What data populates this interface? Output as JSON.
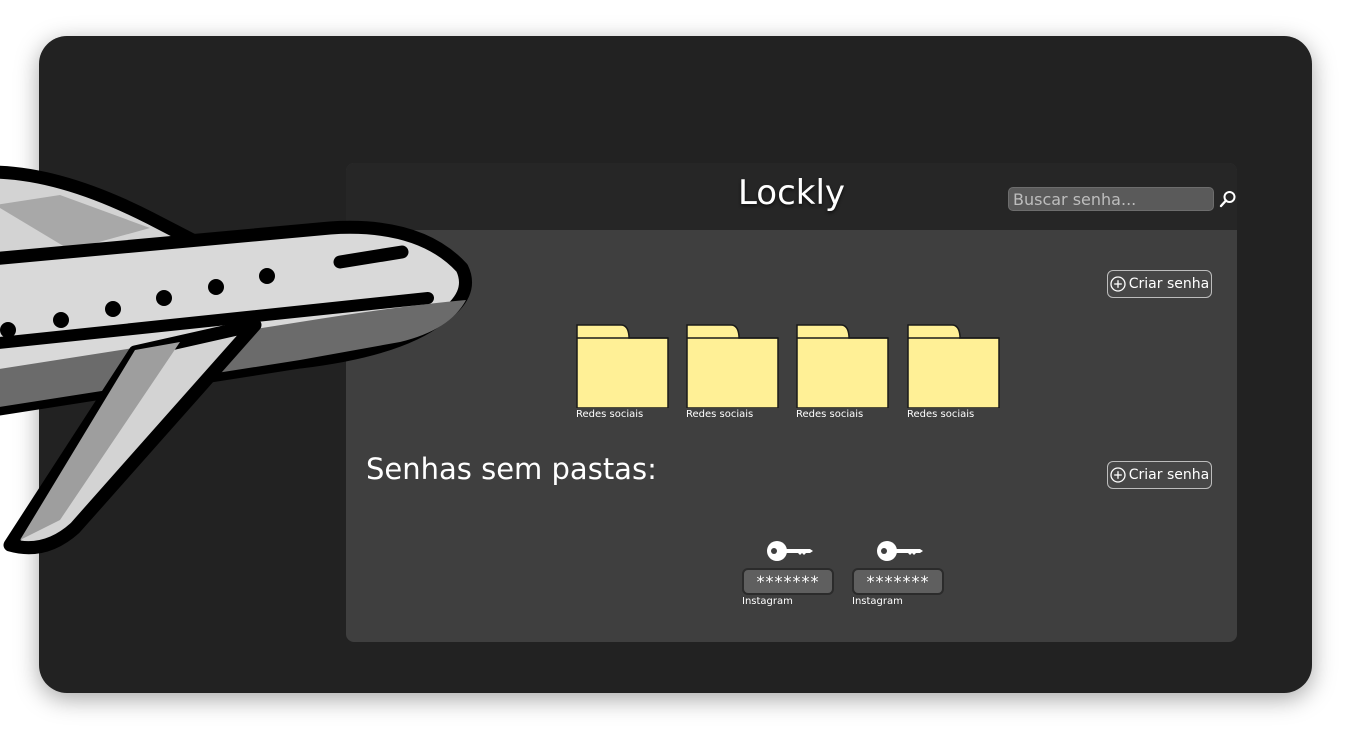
{
  "app": {
    "title": "Lockly"
  },
  "search": {
    "placeholder": "Buscar senha..."
  },
  "buttons": {
    "create_password_top": "Criar senha",
    "create_password_bottom": "Criar senha"
  },
  "folders": [
    {
      "label": "Redes sociais"
    },
    {
      "label": "Redes sociais"
    },
    {
      "label": "Redes sociais"
    },
    {
      "label": "Redes sociais"
    }
  ],
  "unfoldered_section": {
    "title": "Senhas sem pastas:"
  },
  "passwords": [
    {
      "masked": "*******",
      "label": "Instagram"
    },
    {
      "masked": "*******",
      "label": "Instagram"
    }
  ],
  "colors": {
    "frame": "#222222",
    "app_body": "#3f3f3f",
    "app_header": "#262626",
    "folder": "#fff096",
    "field": "#5f5f5f"
  },
  "icons": [
    "search-icon",
    "plus-circle-icon",
    "folder-icon",
    "key-icon",
    "airplane-illustration"
  ]
}
